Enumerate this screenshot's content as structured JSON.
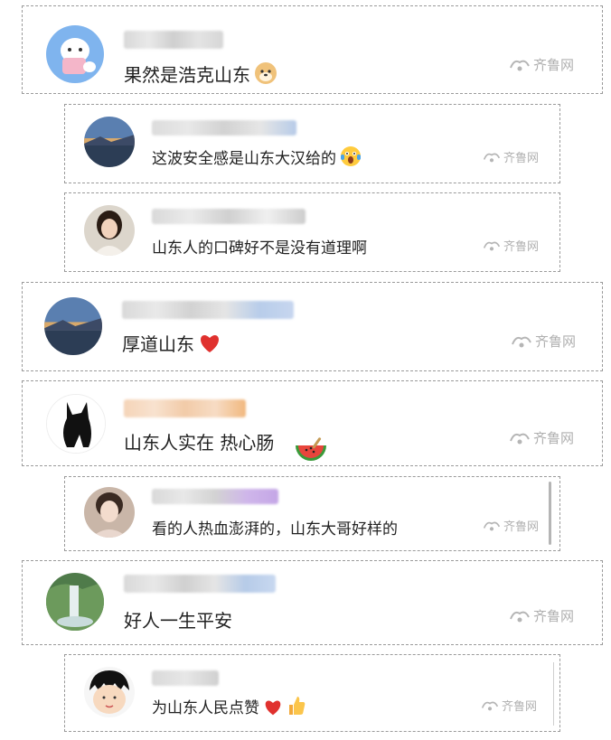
{
  "watermark": {
    "text": "齐鲁网",
    "icon": "qilu-logo-icon"
  },
  "comments": [
    {
      "text": "果然是浩克山东",
      "emoji": "doge-emoji",
      "avatar": "cartoon-avatar"
    },
    {
      "text": "这波安全感是山东大汉给的",
      "emoji": "wow-emoji",
      "avatar": "lake-sunset-avatar"
    },
    {
      "text": "山东人的口碑好不是没有道理啊",
      "emoji": "",
      "avatar": "girl-photo-avatar"
    },
    {
      "text": "厚道山东",
      "emoji": "red-heart-emoji",
      "avatar": "lake-sunset-avatar"
    },
    {
      "text": "山东人实在 热心肠",
      "emoji": "watermelon-emoji",
      "avatar": "black-cat-avatar"
    },
    {
      "text": "看的人热血澎湃的，山东大哥好样的",
      "emoji": "",
      "avatar": "woman-selfie-avatar"
    },
    {
      "text": "好人一生平安",
      "emoji": "",
      "avatar": "waterfall-avatar"
    },
    {
      "text": "为山东人民点赞",
      "emoji": "heart-thumbs-up-emoji",
      "avatar": "cartoon-girl-avatar"
    }
  ]
}
